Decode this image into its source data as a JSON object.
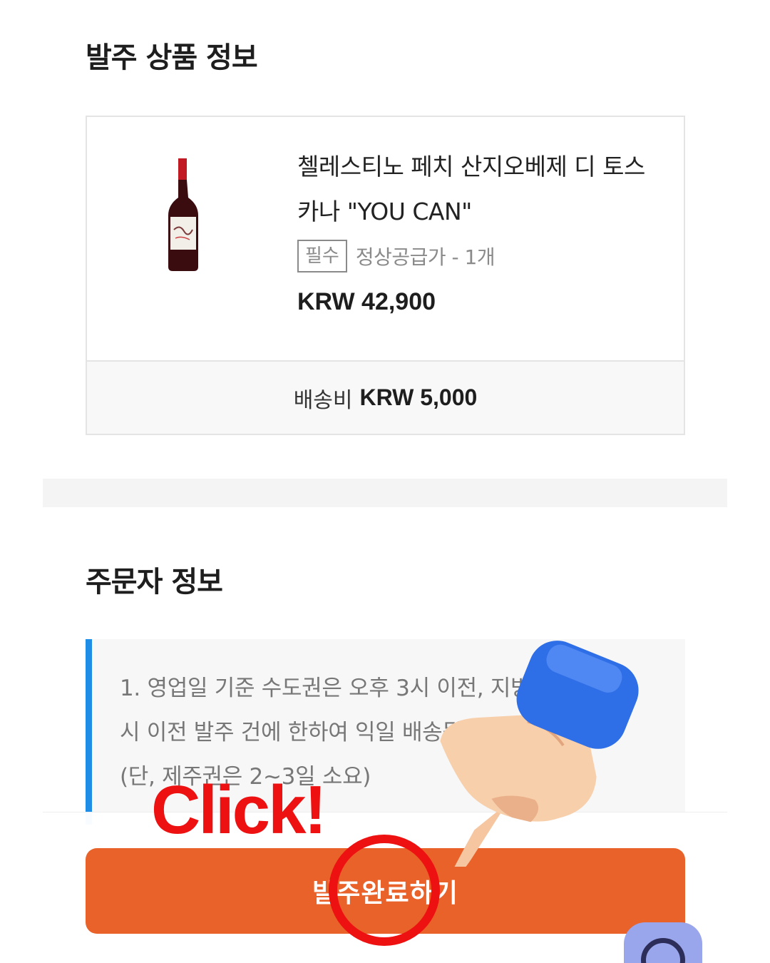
{
  "order_section": {
    "title": "발주 상품 정보",
    "product": {
      "name_line1": "첼레스티노 페치 산지오베제 디 토스",
      "name_line2": "카나 \"YOU CAN\"",
      "option_tag": "필수",
      "option_text": "정상공급가 - 1개",
      "price": "KRW 42,900",
      "image": "wine-bottle"
    },
    "shipping_label": "배송비",
    "shipping_value": "KRW 5,000"
  },
  "customer_section": {
    "title": "주문자 정보",
    "notice_line1": "1. 영업일 기준 수도권은 오후 3시 이전, 지방은 오후 2",
    "notice_line2": "시 이전 발주 건에 한하여 익일 배송됩니다.",
    "notice_line3": "(단, 제주권은 2~3일 소요)"
  },
  "cta": {
    "label": "발주완료하기"
  },
  "overlay": {
    "click_text": "Click!",
    "hand_icon": "pointing-hand",
    "annotation_color": "#ee1111"
  },
  "chat_fab": {
    "icon": "chat-icon"
  },
  "colors": {
    "accent": "#e8622a",
    "notice_border": "#1f8ce6"
  }
}
